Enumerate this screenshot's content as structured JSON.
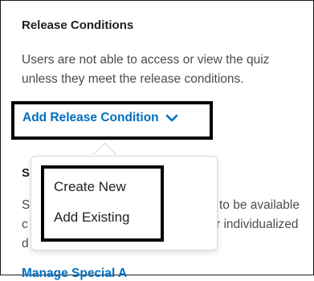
{
  "release_conditions": {
    "title": "Release Conditions",
    "description_line1": "Users are not able to access or view the quiz",
    "description_line2": "unless they meet the release conditions.",
    "add_button_label": "Add Release Condition"
  },
  "background": {
    "heading_fragment": "S",
    "line1_left": "S",
    "line1_right": "to be available",
    "line2_left": "c",
    "line2_right": "r individualized",
    "line3_left": "d",
    "link_fragment": "Manage Special A"
  },
  "dropdown": {
    "items": [
      {
        "label": "Create New"
      },
      {
        "label": "Add Existing"
      }
    ]
  },
  "colors": {
    "link": "#006fbf",
    "heading": "#202122",
    "body_text": "#494c4e"
  }
}
